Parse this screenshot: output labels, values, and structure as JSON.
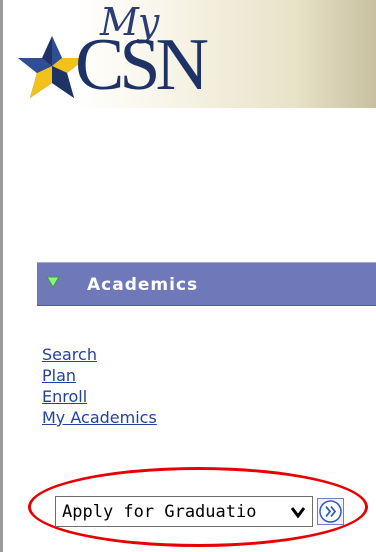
{
  "logo": {
    "prefix_text": "My",
    "brand_text": "CSN",
    "colors": {
      "navy": "#1e3266",
      "gold": "#f2c21a"
    }
  },
  "section": {
    "title": "Academics",
    "expanded_icon": "triangle-down-icon",
    "header_color": "#6f79ba"
  },
  "links": [
    "Search",
    "Plan",
    "Enroll",
    "My Academics"
  ],
  "action_select": {
    "selected_value": "Apply for Graduatio",
    "arrow_icon": "chevron-down-icon"
  },
  "go_button": {
    "icon": "double-chevron-right-icon"
  },
  "highlight": {
    "color": "#e80000"
  }
}
